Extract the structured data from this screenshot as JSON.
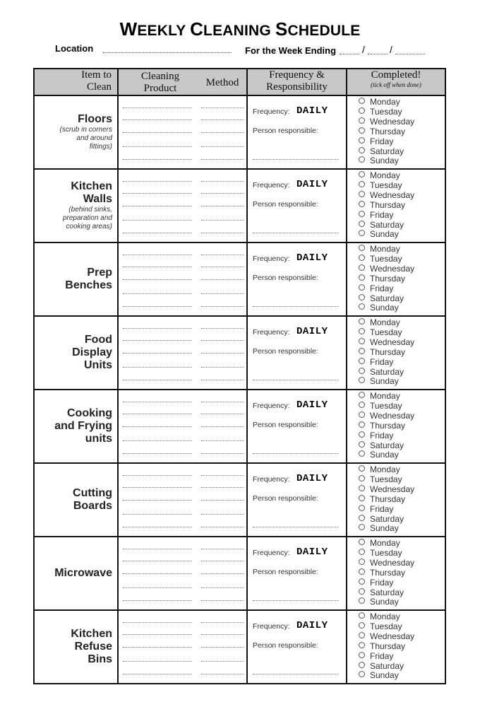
{
  "title": {
    "first_w": "W",
    "first_rest": "EEKLY ",
    "second_w": "C",
    "second_rest": "LEANING ",
    "third_w": "S",
    "third_rest": "CHEDULE"
  },
  "meta": {
    "location_label": "Location",
    "location_value": "",
    "week_ending_label": "For the Week Ending",
    "date_separator": "/"
  },
  "headers": {
    "item_line1": "Item to",
    "item_line2": "Clean",
    "product_line1": "Cleaning",
    "product_line2": "Product",
    "method": "Method",
    "freq_line1": "Frequency &",
    "freq_line2": "Responsibility",
    "completed": "Completed!",
    "completed_sub": "(tick off when done)"
  },
  "labels": {
    "frequency": "Frequency:",
    "person": "Person responsible:"
  },
  "days": [
    "Monday",
    "Tuesday",
    "Wednesday",
    "Thursday",
    "Friday",
    "Saturday",
    "Sunday"
  ],
  "rows": [
    {
      "name_lines": [
        "Floors"
      ],
      "note_lines": [
        "(scrub in corners",
        "and around",
        "fittings)"
      ],
      "frequency": "DAILY"
    },
    {
      "name_lines": [
        "Kitchen",
        "Walls"
      ],
      "note_lines": [
        "(behind sinks,",
        "preparation and",
        "cooking areas)"
      ],
      "frequency": "DAILY"
    },
    {
      "name_lines": [
        "Prep",
        "Benches"
      ],
      "note_lines": [],
      "frequency": "DAILY"
    },
    {
      "name_lines": [
        "Food",
        "Display",
        "Units"
      ],
      "note_lines": [],
      "frequency": "DAILY"
    },
    {
      "name_lines": [
        "Cooking",
        "and Frying",
        "units"
      ],
      "note_lines": [],
      "frequency": "DAILY"
    },
    {
      "name_lines": [
        "Cutting",
        "Boards"
      ],
      "note_lines": [],
      "frequency": "DAILY"
    },
    {
      "name_lines": [
        "Microwave"
      ],
      "note_lines": [],
      "frequency": "DAILY"
    },
    {
      "name_lines": [
        "Kitchen",
        "Refuse",
        "Bins"
      ],
      "note_lines": [],
      "frequency": "DAILY"
    }
  ],
  "colors": {
    "header_bg": "#c8c8c8",
    "border": "#111111"
  }
}
